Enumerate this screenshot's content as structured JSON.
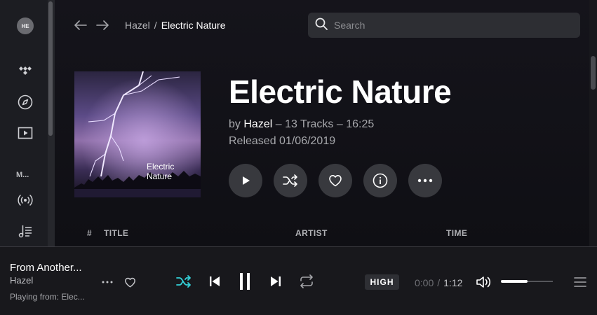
{
  "sidebar": {
    "avatar_initials": "HE",
    "section_label": "M...",
    "icons": [
      "tidal-logo-icon",
      "explore-icon",
      "video-icon",
      "broadcast-icon",
      "playlist-icon"
    ]
  },
  "header": {
    "breadcrumb_artist": "Hazel",
    "breadcrumb_separator": "/",
    "breadcrumb_album": "Electric Nature",
    "search_placeholder": "Search"
  },
  "album": {
    "cover_text": "Electric Nature",
    "title": "Electric Nature",
    "by": "by",
    "artist": "Hazel",
    "details": "– 13 Tracks – 16:25",
    "released": "Released 01/06/2019"
  },
  "track_table": {
    "columns": [
      "#",
      "TITLE",
      "ARTIST",
      "TIME"
    ]
  },
  "player": {
    "track_title": "From Another...",
    "track_artist": "Hazel",
    "playing_from": "Playing from:  Elec...",
    "quality": "HIGH",
    "elapsed": "0:00",
    "separator": "/",
    "duration": "1:12",
    "volume_level": 0.52,
    "accent_color": "#33d1d8"
  }
}
